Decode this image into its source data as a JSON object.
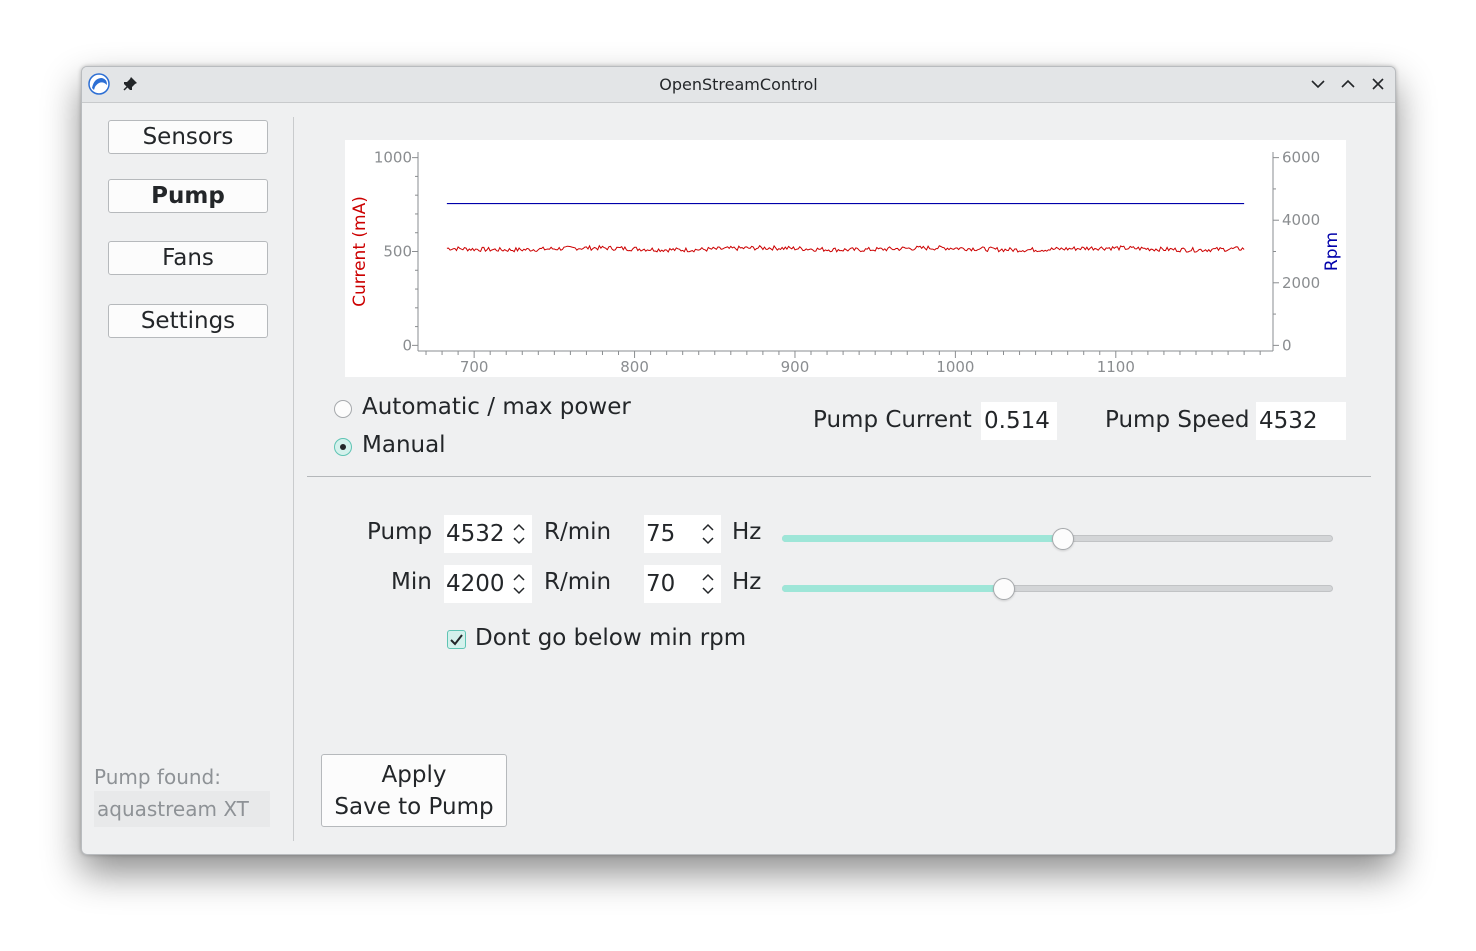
{
  "window": {
    "title": "OpenStreamControl"
  },
  "icons": {
    "app": "app-icon",
    "pin": "pin-icon",
    "minimize": "chevron-down-icon",
    "maximize": "chevron-up-icon",
    "close": "close-icon"
  },
  "sidebar": {
    "items": [
      {
        "label": "Sensors",
        "active": false
      },
      {
        "label": "Pump",
        "active": true
      },
      {
        "label": "Fans",
        "active": false
      },
      {
        "label": "Settings",
        "active": false
      }
    ],
    "found_label": "Pump found:",
    "found_value": "aquastream XT"
  },
  "mode": {
    "options": [
      "Automatic / max power",
      "Manual"
    ],
    "selected": "Manual"
  },
  "readouts": {
    "current_label": "Pump Current",
    "current_value": "0.514",
    "speed_label": "Pump Speed",
    "speed_value": "4532"
  },
  "controls": {
    "pump": {
      "label": "Pump",
      "rpm": "4532",
      "rpm_unit": "R/min",
      "hz": "75",
      "hz_unit": "Hz",
      "slider_fraction": 0.51
    },
    "min": {
      "label": "Min",
      "rpm": "4200",
      "rpm_unit": "R/min",
      "hz": "70",
      "hz_unit": "Hz",
      "slider_fraction": 0.403
    },
    "dont_go_below": {
      "label": "Dont go below min rpm",
      "checked": true
    }
  },
  "apply_button": {
    "line1": "Apply",
    "line2": "Save to Pump"
  },
  "colors": {
    "accent": "#9ee6d8",
    "current_series": "#cc0000",
    "rpm_series": "#0000aa"
  },
  "chart_data": {
    "type": "line",
    "xlabel": "",
    "ylabel": "Current (mA)",
    "y2label": "Rpm",
    "xlim": [
      665,
      1198
    ],
    "ylim": [
      -30,
      1030
    ],
    "y2lim": [
      -180,
      6180
    ],
    "xticks": [
      700,
      800,
      900,
      1000,
      1100
    ],
    "yticks": [
      0,
      500,
      1000
    ],
    "y2ticks": [
      0,
      2000,
      4000,
      6000
    ],
    "grid": false,
    "series": [
      {
        "name": "Current (mA)",
        "axis": "left",
        "x_range": [
          683,
          1180
        ],
        "mean": 514,
        "jitter": 12,
        "seed": 7
      },
      {
        "name": "Rpm",
        "axis": "right",
        "x_range": [
          683,
          1180
        ],
        "value": 4532
      }
    ]
  }
}
